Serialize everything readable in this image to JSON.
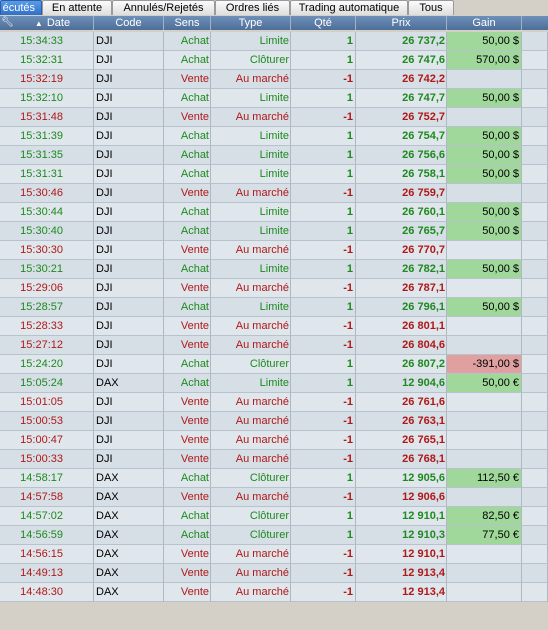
{
  "tabs": [
    {
      "label": "écutés",
      "active": true
    },
    {
      "label": "En attente",
      "active": false
    },
    {
      "label": "Annulés/Rejetés",
      "active": false
    },
    {
      "label": "Ordres liés",
      "active": false
    },
    {
      "label": "Trading automatique",
      "active": false
    },
    {
      "label": "Tous",
      "active": false
    }
  ],
  "columns": {
    "date": "Date",
    "code": "Code",
    "sens": "Sens",
    "type": "Type",
    "qte": "Qté",
    "prix": "Prix",
    "gain": "Gain"
  },
  "colors": {
    "buy": "#1d8a1d",
    "sell": "#b01818",
    "gain_positive_bg": "#9fd89a",
    "gain_negative_bg": "#e1a0a0",
    "header_bg": "#5a7aa5"
  },
  "rows": [
    {
      "date": "15:34:33",
      "code": "DJI",
      "sens": "Achat",
      "type": "Limite",
      "qte": "1",
      "prix": "26 737,2",
      "gain": "50,00 $"
    },
    {
      "date": "15:32:31",
      "code": "DJI",
      "sens": "Achat",
      "type": "Clôturer",
      "qte": "1",
      "prix": "26 747,6",
      "gain": "570,00 $"
    },
    {
      "date": "15:32:19",
      "code": "DJI",
      "sens": "Vente",
      "type": "Au marché",
      "qte": "-1",
      "prix": "26 742,2",
      "gain": ""
    },
    {
      "date": "15:32:10",
      "code": "DJI",
      "sens": "Achat",
      "type": "Limite",
      "qte": "1",
      "prix": "26 747,7",
      "gain": "50,00 $"
    },
    {
      "date": "15:31:48",
      "code": "DJI",
      "sens": "Vente",
      "type": "Au marché",
      "qte": "-1",
      "prix": "26 752,7",
      "gain": ""
    },
    {
      "date": "15:31:39",
      "code": "DJI",
      "sens": "Achat",
      "type": "Limite",
      "qte": "1",
      "prix": "26 754,7",
      "gain": "50,00 $"
    },
    {
      "date": "15:31:35",
      "code": "DJI",
      "sens": "Achat",
      "type": "Limite",
      "qte": "1",
      "prix": "26 756,6",
      "gain": "50,00 $"
    },
    {
      "date": "15:31:31",
      "code": "DJI",
      "sens": "Achat",
      "type": "Limite",
      "qte": "1",
      "prix": "26 758,1",
      "gain": "50,00 $"
    },
    {
      "date": "15:30:46",
      "code": "DJI",
      "sens": "Vente",
      "type": "Au marché",
      "qte": "-1",
      "prix": "26 759,7",
      "gain": ""
    },
    {
      "date": "15:30:44",
      "code": "DJI",
      "sens": "Achat",
      "type": "Limite",
      "qte": "1",
      "prix": "26 760,1",
      "gain": "50,00 $"
    },
    {
      "date": "15:30:40",
      "code": "DJI",
      "sens": "Achat",
      "type": "Limite",
      "qte": "1",
      "prix": "26 765,7",
      "gain": "50,00 $"
    },
    {
      "date": "15:30:30",
      "code": "DJI",
      "sens": "Vente",
      "type": "Au marché",
      "qte": "-1",
      "prix": "26 770,7",
      "gain": ""
    },
    {
      "date": "15:30:21",
      "code": "DJI",
      "sens": "Achat",
      "type": "Limite",
      "qte": "1",
      "prix": "26 782,1",
      "gain": "50,00 $"
    },
    {
      "date": "15:29:06",
      "code": "DJI",
      "sens": "Vente",
      "type": "Au marché",
      "qte": "-1",
      "prix": "26 787,1",
      "gain": ""
    },
    {
      "date": "15:28:57",
      "code": "DJI",
      "sens": "Achat",
      "type": "Limite",
      "qte": "1",
      "prix": "26 796,1",
      "gain": "50,00 $"
    },
    {
      "date": "15:28:33",
      "code": "DJI",
      "sens": "Vente",
      "type": "Au marché",
      "qte": "-1",
      "prix": "26 801,1",
      "gain": ""
    },
    {
      "date": "15:27:12",
      "code": "DJI",
      "sens": "Vente",
      "type": "Au marché",
      "qte": "-1",
      "prix": "26 804,6",
      "gain": ""
    },
    {
      "date": "15:24:20",
      "code": "DJI",
      "sens": "Achat",
      "type": "Clôturer",
      "qte": "1",
      "prix": "26 807,2",
      "gain": "-391,00 $"
    },
    {
      "date": "15:05:24",
      "code": "DAX",
      "sens": "Achat",
      "type": "Limite",
      "qte": "1",
      "prix": "12 904,6",
      "gain": "50,00 €"
    },
    {
      "date": "15:01:05",
      "code": "DJI",
      "sens": "Vente",
      "type": "Au marché",
      "qte": "-1",
      "prix": "26 761,6",
      "gain": ""
    },
    {
      "date": "15:00:53",
      "code": "DJI",
      "sens": "Vente",
      "type": "Au marché",
      "qte": "-1",
      "prix": "26 763,1",
      "gain": ""
    },
    {
      "date": "15:00:47",
      "code": "DJI",
      "sens": "Vente",
      "type": "Au marché",
      "qte": "-1",
      "prix": "26 765,1",
      "gain": ""
    },
    {
      "date": "15:00:33",
      "code": "DJI",
      "sens": "Vente",
      "type": "Au marché",
      "qte": "-1",
      "prix": "26 768,1",
      "gain": ""
    },
    {
      "date": "14:58:17",
      "code": "DAX",
      "sens": "Achat",
      "type": "Clôturer",
      "qte": "1",
      "prix": "12 905,6",
      "gain": "112,50 €"
    },
    {
      "date": "14:57:58",
      "code": "DAX",
      "sens": "Vente",
      "type": "Au marché",
      "qte": "-1",
      "prix": "12 906,6",
      "gain": ""
    },
    {
      "date": "14:57:02",
      "code": "DAX",
      "sens": "Achat",
      "type": "Clôturer",
      "qte": "1",
      "prix": "12 910,1",
      "gain": "82,50 €"
    },
    {
      "date": "14:56:59",
      "code": "DAX",
      "sens": "Achat",
      "type": "Clôturer",
      "qte": "1",
      "prix": "12 910,3",
      "gain": "77,50 €"
    },
    {
      "date": "14:56:15",
      "code": "DAX",
      "sens": "Vente",
      "type": "Au marché",
      "qte": "-1",
      "prix": "12 910,1",
      "gain": ""
    },
    {
      "date": "14:49:13",
      "code": "DAX",
      "sens": "Vente",
      "type": "Au marché",
      "qte": "-1",
      "prix": "12 913,4",
      "gain": ""
    },
    {
      "date": "14:48:30",
      "code": "DAX",
      "sens": "Vente",
      "type": "Au marché",
      "qte": "-1",
      "prix": "12 913,4",
      "gain": ""
    }
  ]
}
